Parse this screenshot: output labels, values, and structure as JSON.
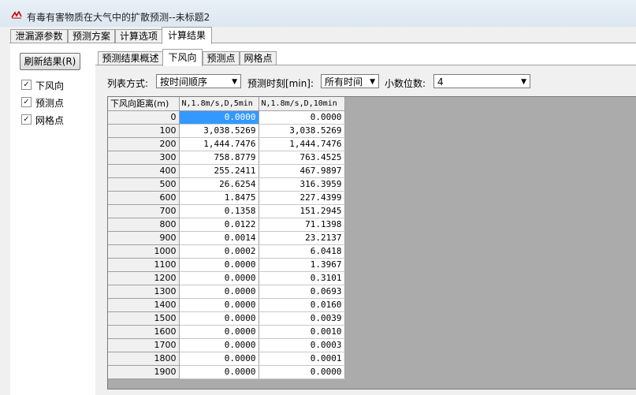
{
  "window": {
    "title": "有毒有害物质在大气中的扩散预测--未标题2"
  },
  "main_tabs": [
    "泄漏源参数",
    "预测方案",
    "计算选项",
    "计算结果"
  ],
  "left_panel": {
    "refresh_label": "刷新结果(R)",
    "checkboxes": [
      {
        "label": "下风向",
        "checked": true
      },
      {
        "label": "预测点",
        "checked": true
      },
      {
        "label": "网格点",
        "checked": true
      }
    ]
  },
  "sub_tabs": [
    "预测结果概述",
    "下风向",
    "预测点",
    "网格点"
  ],
  "options": {
    "list_mode_label": "列表方式:",
    "list_mode_value": "按时间顺序",
    "time_label": "预测时刻[min]:",
    "time_value": "所有时间",
    "decimals_label": "小数位数:",
    "decimals_value": "4"
  },
  "table": {
    "headers": [
      "下风向距离(m)",
      "N,1.8m/s,D,5min",
      "N,1.8m/s,D,10min"
    ],
    "rows": [
      [
        "0",
        "0.0000",
        "0.0000"
      ],
      [
        "100",
        "3,038.5269",
        "3,038.5269"
      ],
      [
        "200",
        "1,444.7476",
        "1,444.7476"
      ],
      [
        "300",
        "758.8779",
        "763.4525"
      ],
      [
        "400",
        "255.2411",
        "467.9897"
      ],
      [
        "500",
        "26.6254",
        "316.3959"
      ],
      [
        "600",
        "1.8475",
        "227.4399"
      ],
      [
        "700",
        "0.1358",
        "151.2945"
      ],
      [
        "800",
        "0.0122",
        "71.1398"
      ],
      [
        "900",
        "0.0014",
        "23.2137"
      ],
      [
        "1000",
        "0.0002",
        "6.0418"
      ],
      [
        "1100",
        "0.0000",
        "1.3967"
      ],
      [
        "1200",
        "0.0000",
        "0.3101"
      ],
      [
        "1300",
        "0.0000",
        "0.0693"
      ],
      [
        "1400",
        "0.0000",
        "0.0160"
      ],
      [
        "1500",
        "0.0000",
        "0.0039"
      ],
      [
        "1600",
        "0.0000",
        "0.0010"
      ],
      [
        "1700",
        "0.0000",
        "0.0003"
      ],
      [
        "1800",
        "0.0000",
        "0.0001"
      ],
      [
        "1900",
        "0.0000",
        "0.0000"
      ]
    ]
  },
  "icons": {
    "app": "app-logo-icon",
    "dropdown": "chevron-down-icon",
    "check": "checkmark-icon"
  },
  "colors": {
    "selection": "#3399ff",
    "grid_background": "#ababab"
  }
}
